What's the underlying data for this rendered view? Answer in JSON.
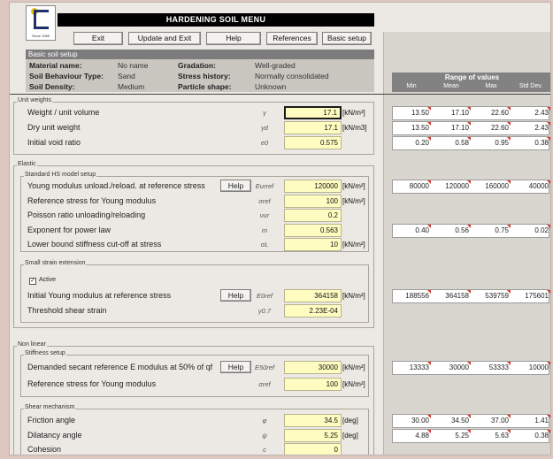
{
  "logo": {
    "small_text": "Since 1985"
  },
  "menu_title": "HARDENING SOIL MENU",
  "toolbar": {
    "exit": "Exit",
    "update_exit": "Update and Exit",
    "help": "Help",
    "references": "References",
    "basic_setup": "Basic setup"
  },
  "basic_soil_setup": {
    "heading": "Basic soil setup",
    "material_name_label": "Material name:",
    "material_name_value": "No name",
    "soil_behaviour_label": "Soil Behaviour Type:",
    "soil_behaviour_value": "Sand",
    "soil_density_label": "Soil Density:",
    "soil_density_value": "Medium",
    "gradation_label": "Gradation:",
    "gradation_value": "Well-graded",
    "stress_history_label": "Stress history:",
    "stress_history_value": "Normally consolidated",
    "particle_shape_label": "Particle shape:",
    "particle_shape_value": "Unknown"
  },
  "range": {
    "title": "Range of values",
    "cols": [
      "Min",
      "Mean",
      "Max",
      "Std Dev."
    ]
  },
  "unit_weights": {
    "group_label": "Unit weights",
    "rows": [
      {
        "label": "Weight / unit volume",
        "symbol": "γ",
        "value": "17.1",
        "unit": "[kN/m³]",
        "range": [
          "13.50",
          "17.10",
          "22.60",
          "2.43"
        ]
      },
      {
        "label": "Dry unit weight",
        "symbol": "γd",
        "value": "17.1",
        "unit": "[kN/m3]",
        "range": [
          "13.50",
          "17.10",
          "22.60",
          "2.43"
        ]
      },
      {
        "label": "Initial void ratio",
        "symbol": "e0",
        "value": "0.575",
        "unit": "",
        "range": [
          "0.20",
          "0.58",
          "0.95",
          "0.38"
        ]
      }
    ]
  },
  "elastic": {
    "group_label": "Elastic",
    "hs_group_label": "Standard HS model setup",
    "rows": [
      {
        "label": "Young modulus unload./reload. at reference stress",
        "symbol": "Eurref",
        "value": "120000",
        "unit": "[kN/m²]",
        "help": "Help",
        "range": [
          "80000",
          "120000",
          "160000",
          "40000"
        ]
      },
      {
        "label": "Reference stress for Young modulus",
        "symbol": "σref",
        "value": "100",
        "unit": "[kN/m²]"
      },
      {
        "label": "Poisson ratio unloading/reloading",
        "symbol": "νur",
        "value": "0.2",
        "unit": ""
      },
      {
        "label": "Exponent for power law",
        "symbol": "m",
        "value": "0.563",
        "unit": "",
        "range": [
          "0.40",
          "0.56",
          "0.75",
          "0.02"
        ]
      },
      {
        "label": "Lower bound stiffness cut-off at stress",
        "symbol": "σL",
        "value": "10",
        "unit": "[kN/m²]"
      }
    ],
    "small_strain_label": "Small strain extension",
    "active_label": "Active",
    "active_check": "✓",
    "ss_rows": [
      {
        "label": "Initial Young modulus at reference stress",
        "symbol": "E0ref",
        "value": "364158",
        "unit": "[kN/m²]",
        "help": "Help",
        "range": [
          "188556",
          "364158",
          "539759",
          "175601"
        ]
      },
      {
        "label": "Threshold shear strain",
        "symbol": "γ0.7",
        "value": "2.23E-04",
        "unit": ""
      }
    ]
  },
  "non_linear": {
    "group_label": "Non linear",
    "stiffness_label": "Stiffness setup",
    "stiffness_rows": [
      {
        "label": "Demanded secant reference E modulus at 50% of qf",
        "symbol": "E50ref",
        "value": "30000",
        "unit": "[kN/m²]",
        "help": "Help",
        "range": [
          "13333",
          "30000",
          "53333",
          "10000"
        ]
      },
      {
        "label": "Reference stress for Young modulus",
        "symbol": "σref",
        "value": "100",
        "unit": "[kN/m²]"
      }
    ],
    "shear_label": "Shear mechanism",
    "shear_rows": [
      {
        "label": "Friction angle",
        "symbol": "φ",
        "value": "34.5",
        "unit": "[deg]",
        "range": [
          "30.00",
          "34.50",
          "37.00",
          "1.41"
        ]
      },
      {
        "label": "Dilatancy angle",
        "symbol": "ψ",
        "value": "5.25",
        "unit": "[deg]",
        "range": [
          "4.88",
          "5.25",
          "5.63",
          "0.38"
        ]
      },
      {
        "label": "Cohesion",
        "symbol": "c",
        "value": "0",
        "unit": ""
      }
    ]
  },
  "colors": {
    "accent_yellow": "#fefcc1",
    "comment_marker": "#d23b2b",
    "header_gray": "#7c7c7c"
  }
}
